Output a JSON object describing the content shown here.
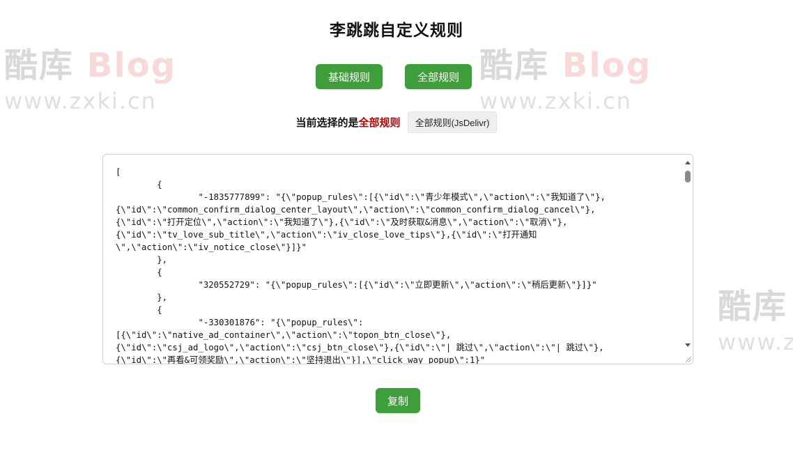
{
  "page": {
    "title": "李跳跳自定义规则"
  },
  "buttons": {
    "basic_rules": "基础规则",
    "all_rules": "全部规则",
    "copy": "复制"
  },
  "current": {
    "label": "当前选择的是",
    "value": "全部规则",
    "source_option": "全部规则(JsDelivr)"
  },
  "rules_text": "[\n        {\n                \"-1835777899\": \"{\\\"popup_rules\\\":[{\\\"id\\\":\\\"青少年模式\\\",\\\"action\\\":\\\"我知道了\\\"},\n{\\\"id\\\":\\\"common_confirm_dialog_center_layout\\\",\\\"action\\\":\\\"common_confirm_dialog_cancel\\\"},\n{\\\"id\\\":\\\"打开定位\\\",\\\"action\\\":\\\"我知道了\\\"},{\\\"id\\\":\\\"及时获取&消息\\\",\\\"action\\\":\\\"取消\\\"},\n{\\\"id\\\":\\\"tv_love_sub_title\\\",\\\"action\\\":\\\"iv_close_love_tips\\\"},{\\\"id\\\":\\\"打开通知\n\\\",\\\"action\\\":\\\"iv_notice_close\\\"}]}\"\n        },\n        {\n                \"320552729\": \"{\\\"popup_rules\\\":[{\\\"id\\\":\\\"立即更新\\\",\\\"action\\\":\\\"稍后更新\\\"}]}\"\n        },\n        {\n                \"-330301876\": \"{\\\"popup_rules\\\":\n[{\\\"id\\\":\\\"native_ad_container\\\",\\\"action\\\":\\\"topon_btn_close\\\"},\n{\\\"id\\\":\\\"csj_ad_logo\\\",\\\"action\\\":\\\"csj_btn_close\\\"},{\\\"id\\\":\\\"| 跳过\\\",\\\"action\\\":\\\"| 跳过\\\"},\n{\\\"id\\\":\\\"再看&可领奖励\\\",\\\"action\\\":\\\"坚持退出\\\"}],\\\"click_way_popup\\\":1}\"",
  "watermark": {
    "brand_cn": "酷库",
    "brand_en": "Blog",
    "url": "www.zxki.cn"
  }
}
